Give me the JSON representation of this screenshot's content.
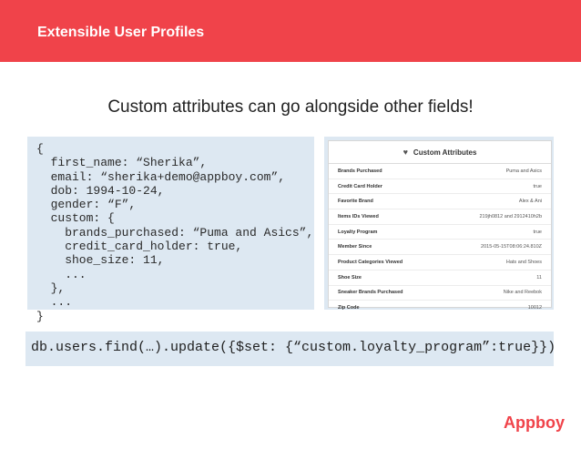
{
  "header": {
    "title": "Extensible User Profiles",
    "bg_color": "#f0434a"
  },
  "subtitle": "Custom attributes can go alongside other fields!",
  "code": {
    "lines": [
      "{",
      "  first_name: “Sherika”,",
      "  email: “sherika+demo@appboy.com”,",
      "  dob: 1994-10-24,",
      "  gender: “F”,",
      "  custom: {",
      "    brands_purchased: “Puma and Asics”,",
      "    credit_card_holder: true,",
      "    shoe_size: 11,",
      "    ...",
      "  },",
      "  ...",
      "}"
    ]
  },
  "panel": {
    "title": "Custom Attributes",
    "icon": "heart-icon",
    "rows": [
      {
        "key": "Brands Purchased",
        "value": "Puma and Asics"
      },
      {
        "key": "Credit Card Holder",
        "value": "true"
      },
      {
        "key": "Favorite Brand",
        "value": "Alex & Ani"
      },
      {
        "key": "Items IDs Viewed",
        "value": "219jh0812 and 2912410h2b"
      },
      {
        "key": "Loyalty Program",
        "value": "true"
      },
      {
        "key": "Member Since",
        "value": "2015-05-15T08:06:24.810Z"
      },
      {
        "key": "Product Categories Viewed",
        "value": "Hats and Shoes"
      },
      {
        "key": "Shoe Size",
        "value": "11"
      },
      {
        "key": "Sneaker Brands Purchased",
        "value": "Nike and Reebok"
      },
      {
        "key": "Zip Code",
        "value": "10012"
      }
    ]
  },
  "command": "db.users.find(…).update({$set: {“custom.loyalty_program”:true}})",
  "logo": "Appboy",
  "colors": {
    "accent": "#f0434a",
    "code_bg": "#dde8f2"
  }
}
